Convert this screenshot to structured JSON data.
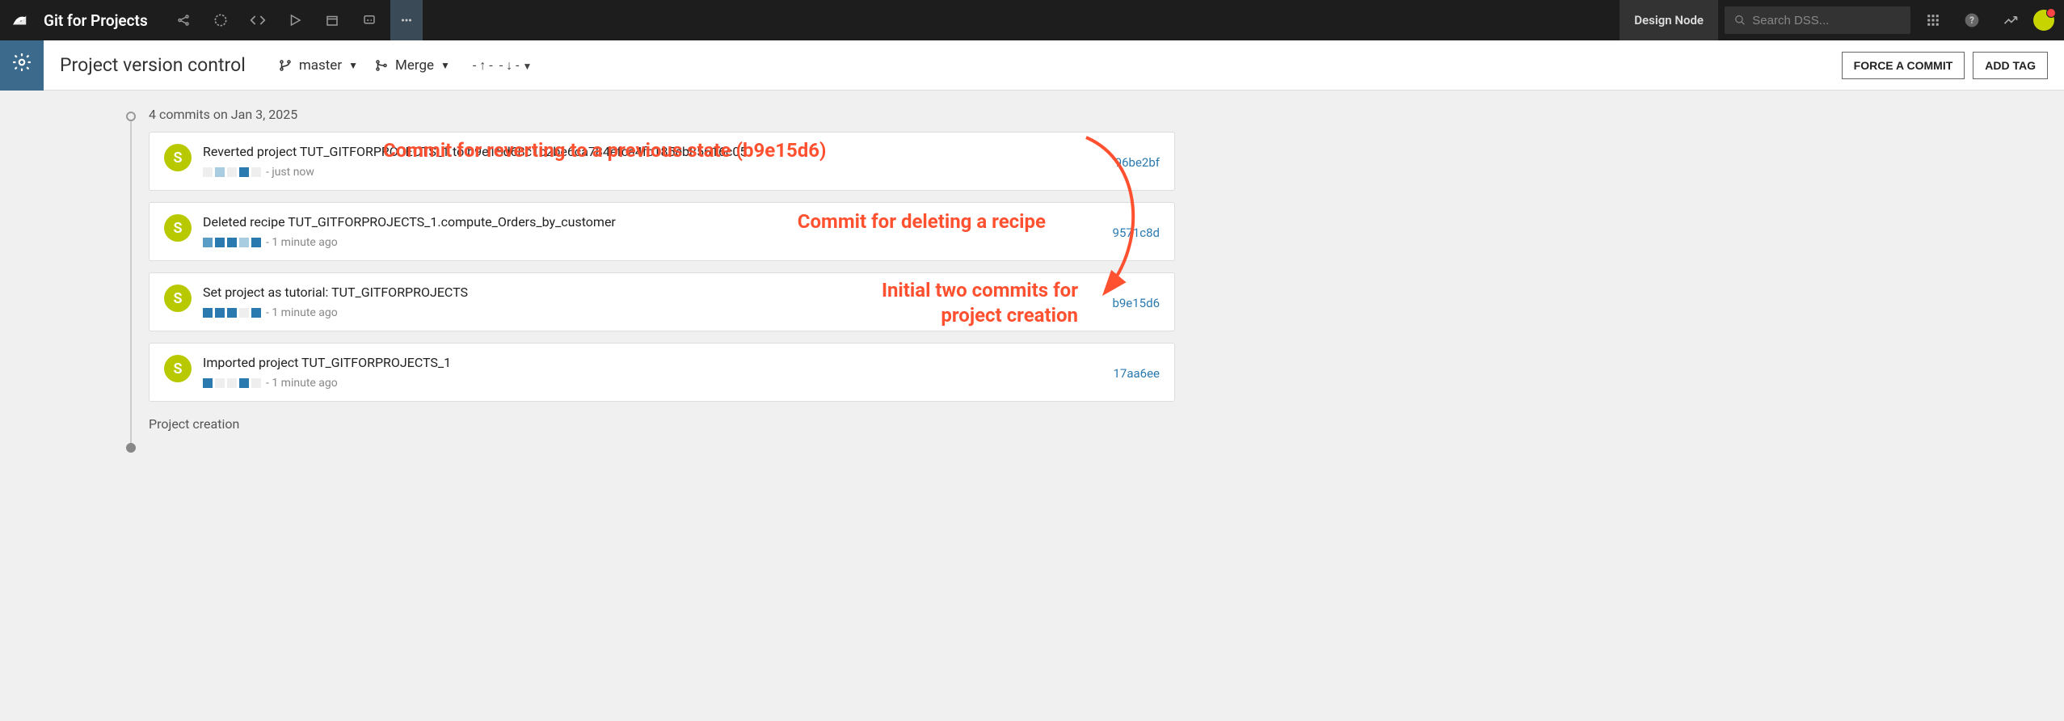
{
  "header": {
    "project_name": "Git for Projects",
    "design_node": "Design Node",
    "search_placeholder": "Search DSS..."
  },
  "subheader": {
    "title": "Project version control",
    "branch": "master",
    "merge_label": "Merge",
    "push_label": "- ↑ -",
    "pull_label": "- ↓ -",
    "force_commit": "FORCE A COMMIT",
    "add_tag": "ADD TAG"
  },
  "timeline": {
    "date_header": "4 commits on Jan 3, 2025",
    "creation_label": "Project creation"
  },
  "commits": [
    {
      "avatar": "S",
      "message": "Reverted project TUT_GITFORPROJECTS_1 to b9e15d68c1c2be6ca784efca4fc185eb85616c05",
      "time": "- just now",
      "hash": "96be2bf",
      "diff": [
        "empty",
        "add-light",
        "empty",
        "add-dark",
        "empty"
      ]
    },
    {
      "avatar": "S",
      "message": "Deleted recipe TUT_GITFORPROJECTS_1.compute_Orders_by_customer",
      "time": "- 1 minute ago",
      "hash": "9571c8d",
      "diff": [
        "add-mid",
        "add-dark",
        "add-dark",
        "add-light",
        "add-dark"
      ]
    },
    {
      "avatar": "S",
      "message": "Set project as tutorial: TUT_GITFORPROJECTS",
      "time": "- 1 minute ago",
      "hash": "b9e15d6",
      "diff": [
        "add-dark",
        "add-dark",
        "add-dark",
        "empty",
        "add-dark"
      ]
    },
    {
      "avatar": "S",
      "message": "Imported project TUT_GITFORPROJECTS_1",
      "time": "- 1 minute ago",
      "hash": "17aa6ee",
      "diff": [
        "add-dark",
        "empty",
        "empty",
        "add-dark",
        "empty"
      ]
    }
  ],
  "annotations": {
    "a1": "Commit for reverting to a previous state (b9e15d6)",
    "a2": "Commit for deleting a recipe",
    "a3": "Initial two commits for\nproject creation"
  }
}
